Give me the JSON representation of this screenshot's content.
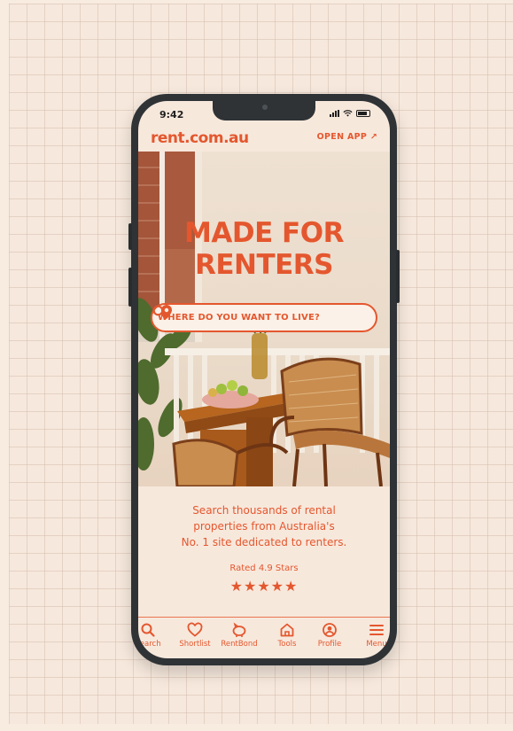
{
  "status_bar": {
    "time": "9:42"
  },
  "header": {
    "logo": "rent.com.au",
    "open_app": "OPEN APP ↗"
  },
  "hero": {
    "headline_line1": "MADE FOR",
    "headline_line2": "RENTERS",
    "search_placeholder": "WHERE DO YOU WANT TO LIVE?"
  },
  "info": {
    "description_line1": "Search thousands of rental",
    "description_line2": "properties from Australia's",
    "description_line3": "No. 1 site dedicated to renters.",
    "rated": "Rated 4.9 Stars",
    "stars": "★★★★★"
  },
  "nav": {
    "items": [
      {
        "label": "Search",
        "icon": "search-icon"
      },
      {
        "label": "Shortlist",
        "icon": "heart-icon"
      },
      {
        "label": "RentBond",
        "icon": "piggy-bank-icon"
      },
      {
        "label": "Tools",
        "icon": "home-icon"
      },
      {
        "label": "Profile",
        "icon": "profile-icon"
      },
      {
        "label": "Menu",
        "icon": "menu-icon"
      }
    ]
  },
  "colors": {
    "accent": "#e4572e",
    "background": "#f7e8dc",
    "frame": "#2f3336"
  }
}
